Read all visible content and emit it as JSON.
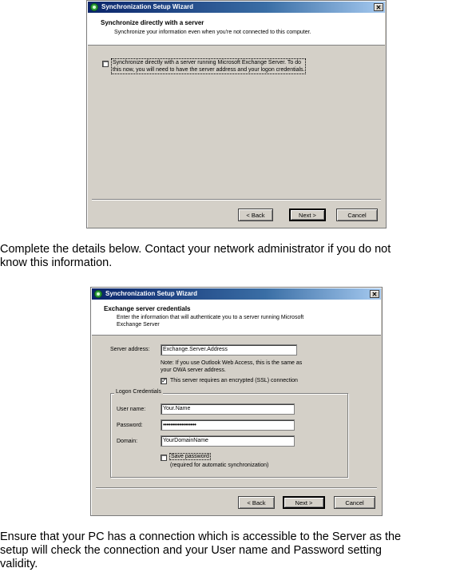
{
  "dialog1": {
    "title": "Synchronization Setup Wizard",
    "close_glyph": "✕",
    "header_title": "Synchronize directly with a server",
    "header_desc": "Synchronize your information even when you're not connected to this computer.",
    "checkbox_line1": "Synchronize directly with a server running Microsoft Exchange Server.  To do",
    "checkbox_line2": "this now, you will need to have the server address and your logon credentials.",
    "checkbox_checked": false,
    "back_label": "< Back",
    "next_label": "Next >",
    "cancel_label": "Cancel"
  },
  "paragraph1": {
    "line1": "Complete the details below. Contact your network administrator if you do not",
    "line2": "know this information."
  },
  "dialog2": {
    "title": "Synchronization Setup Wizard",
    "close_glyph": "✕",
    "header_title": "Exchange server credentials",
    "header_desc_line1": "Enter the information that will authenticate you to a server running Microsoft",
    "header_desc_line2": "Exchange Server",
    "server_address_label": "Server address:",
    "server_address_value": "Exchange.Server.Address",
    "note_line1": "Note: If you use Outlook Web Access, this is the same as",
    "note_line2": "your OWA server address.",
    "ssl_label": "This server requires an encrypted (SSL) connection",
    "ssl_checked": true,
    "check_glyph": "✓",
    "group_label": "Logon Credentials",
    "username_label": "User name:",
    "username_value": "Your.Name",
    "password_label": "Password:",
    "password_value": "••••••••••••••••••",
    "domain_label": "Domain:",
    "domain_value": "YourDomainName",
    "save_password_label": "Save password",
    "save_password_checked": false,
    "save_password_note": "(required for automatic synchronization)",
    "back_label": "< Back",
    "next_label": "Next >",
    "cancel_label": "Cancel"
  },
  "paragraph2": {
    "line1": "Ensure that your PC has a connection which is accessible to the Server as the",
    "line2": "setup will check the connection and your User name and Password setting",
    "line3": "validity."
  }
}
